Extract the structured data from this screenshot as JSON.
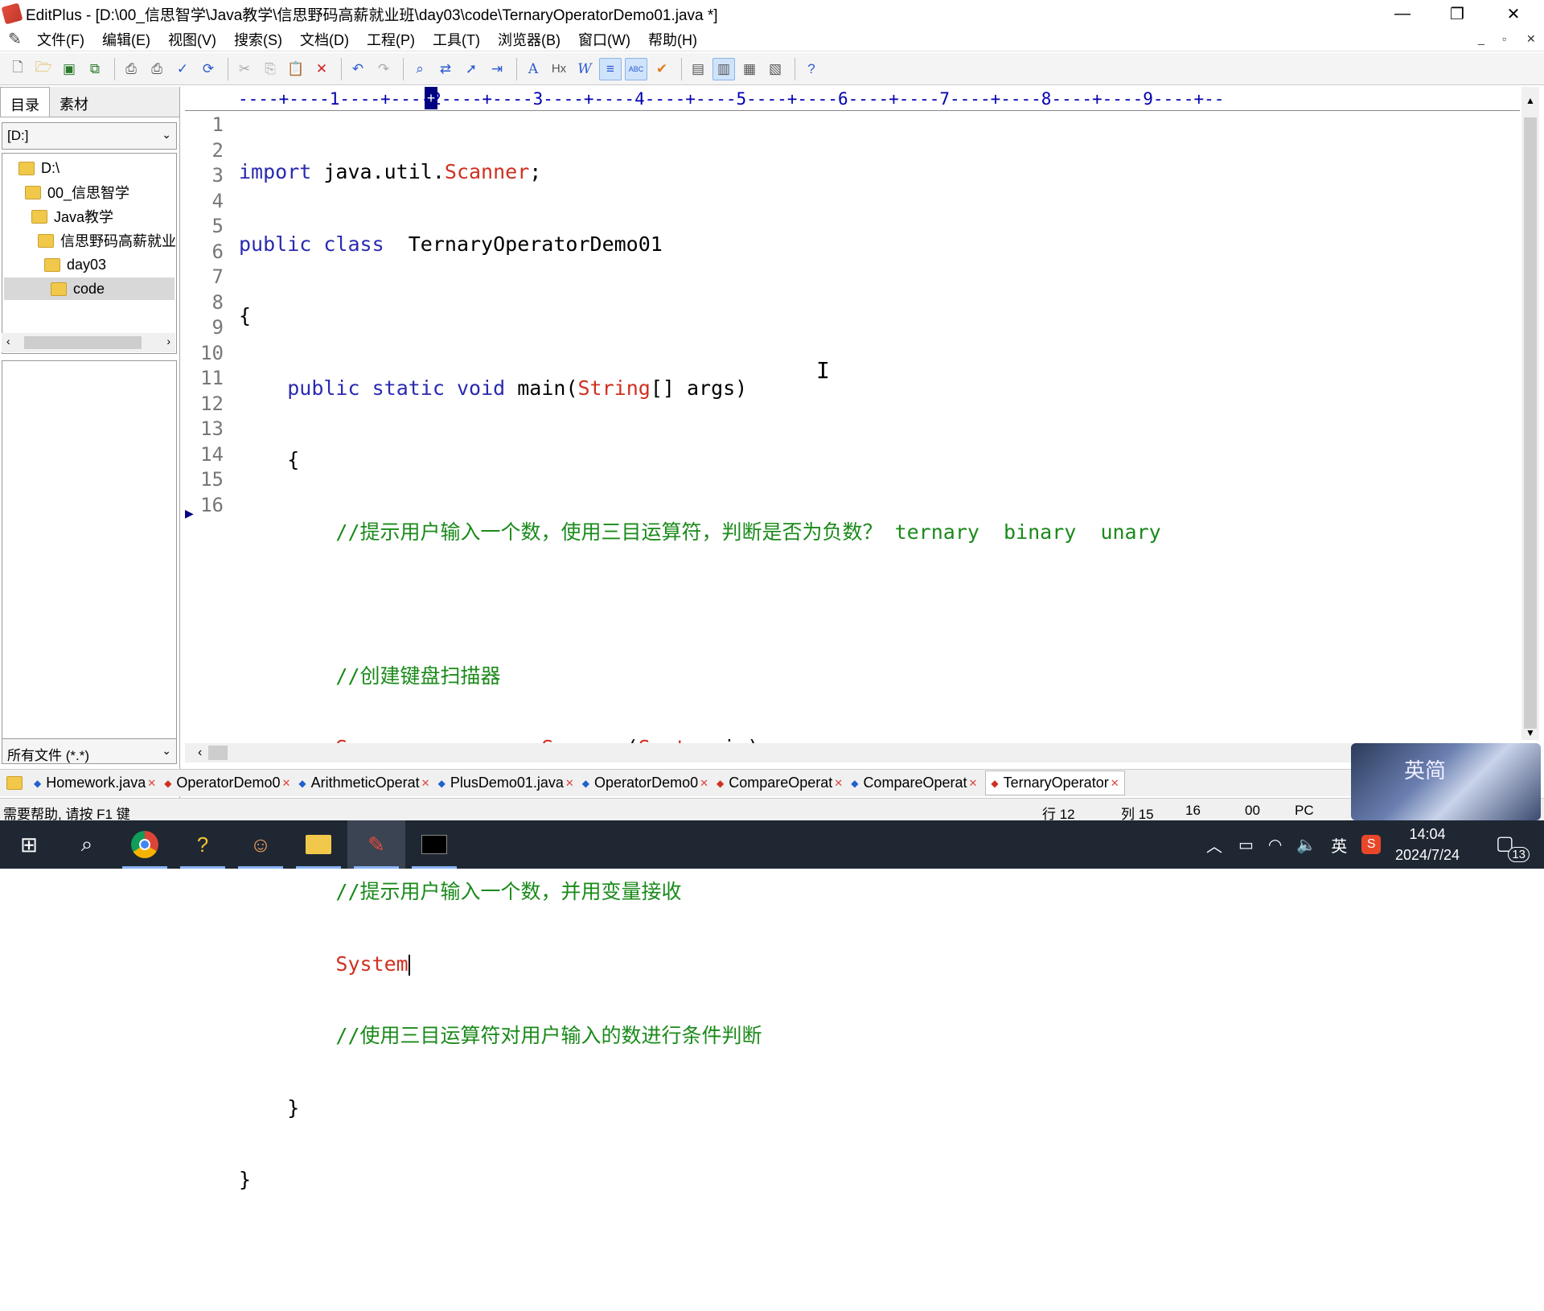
{
  "window": {
    "title": "EditPlus - [D:\\00_信思智学\\Java教学\\信思野码高薪就业班\\day03\\code\\TernaryOperatorDemo01.java *]",
    "controls": {
      "minimize": "—",
      "restore": "❐",
      "close": "✕"
    }
  },
  "menu": [
    "文件(F)",
    "编辑(E)",
    "视图(V)",
    "搜索(S)",
    "文档(D)",
    "工程(P)",
    "工具(T)",
    "浏览器(B)",
    "窗口(W)",
    "帮助(H)"
  ],
  "mdi_controls": {
    "minimize": "_",
    "restore": "▫",
    "close": "✕"
  },
  "toolbar": {
    "icons": [
      "new-file-icon",
      "open-file-icon",
      "save-icon",
      "save-all-icon",
      "print-preview-icon",
      "print-icon",
      "spell-check-icon",
      "reload-icon",
      "cut-icon",
      "copy-icon",
      "paste-icon",
      "delete-icon",
      "undo-icon",
      "redo-icon",
      "find-icon",
      "replace-icon",
      "goto-icon",
      "indent-icon",
      "font-icon",
      "hx-icon",
      "word-wrap-icon",
      "line-number-icon",
      "ruler-icon",
      "check-icon",
      "browser-icon",
      "view-icon",
      "clip-icon",
      "window-icon",
      "help-icon"
    ],
    "glyphs": {
      "hx": "Hx",
      "w": "W",
      "abc": "ABC"
    }
  },
  "sidebar": {
    "tabs": [
      "目录",
      "素材"
    ],
    "drive": "[D:]",
    "tree": [
      {
        "label": "D:\\",
        "level": 0
      },
      {
        "label": "00_信思智学",
        "level": 1
      },
      {
        "label": "Java教学",
        "level": 2
      },
      {
        "label": "信思野码高薪就业",
        "level": 3
      },
      {
        "label": "day03",
        "level": 4
      },
      {
        "label": "code",
        "level": 5,
        "selected": true
      }
    ],
    "filter": "所有文件 (*.*)"
  },
  "ruler": "----+----1----+----2----+----3----+----4----+----5----+----6----+----7----+----8----+----9----+--",
  "editor": {
    "line_numbers": [
      "1",
      "2",
      "3",
      "4",
      "5",
      "6",
      "7",
      "8",
      "9",
      "10",
      "11",
      "12",
      "13",
      "14",
      "15",
      "16"
    ],
    "lines": {
      "l1": {
        "kw": "import",
        "t1": " java.util.",
        "cls": "Scanner",
        "t2": ";"
      },
      "l2": {
        "kw1": "public",
        "kw2": "class",
        "t": "  TernaryOperatorDemo01"
      },
      "l3": "{",
      "l4": {
        "indent": "    ",
        "kw1": "public",
        "kw2": "static",
        "kw3": "void",
        "t1": " main(",
        "cls": "String",
        "t2": "[] args)"
      },
      "l5": "    {",
      "l6": "        //提示用户输入一个数，使用三目运算符，判断是否为负数？ ternary  binary  unary",
      "l8": "        //创建键盘扫描器",
      "l9": {
        "indent": "        ",
        "cls1": "Scanner",
        "t1": " sc = ",
        "kw": "new",
        "cls2": "Scanner",
        "t2": "(",
        "cls3": "System",
        "t3": ".in);"
      },
      "l11": "        //提示用户输入一个数，并用变量接收",
      "l12": {
        "indent": "        ",
        "cls": "System"
      },
      "l13": "        //使用三目运算符对用户输入的数进行条件判断",
      "l14": "    }",
      "l15": "}"
    }
  },
  "doc_tabs": [
    {
      "label": "Homework.java",
      "active": false
    },
    {
      "label": "OperatorDemo0",
      "active": false
    },
    {
      "label": "ArithmeticOperat",
      "active": false
    },
    {
      "label": "PlusDemo01.java",
      "active": false
    },
    {
      "label": "OperatorDemo0",
      "active": false
    },
    {
      "label": "CompareOperat",
      "active": false
    },
    {
      "label": "CompareOperat",
      "active": false
    },
    {
      "label": "TernaryOperator",
      "active": true
    }
  ],
  "status": {
    "help": "需要帮助, 请按 F1 键",
    "row": "行 12",
    "col": "列 15",
    "lines": "16",
    "code": "00",
    "mode": "PC"
  },
  "overlay": {
    "text": "英简"
  },
  "taskbar": {
    "icons": [
      "windows-start-icon",
      "search-icon",
      "chrome-icon",
      "sticky-help-icon",
      "people-icon",
      "file-explorer-icon",
      "editplus-icon",
      "terminal-icon"
    ],
    "tray": {
      "ime": "英",
      "clock_time": "14:04",
      "clock_date": "2024/7/24",
      "notifications": "13"
    }
  }
}
